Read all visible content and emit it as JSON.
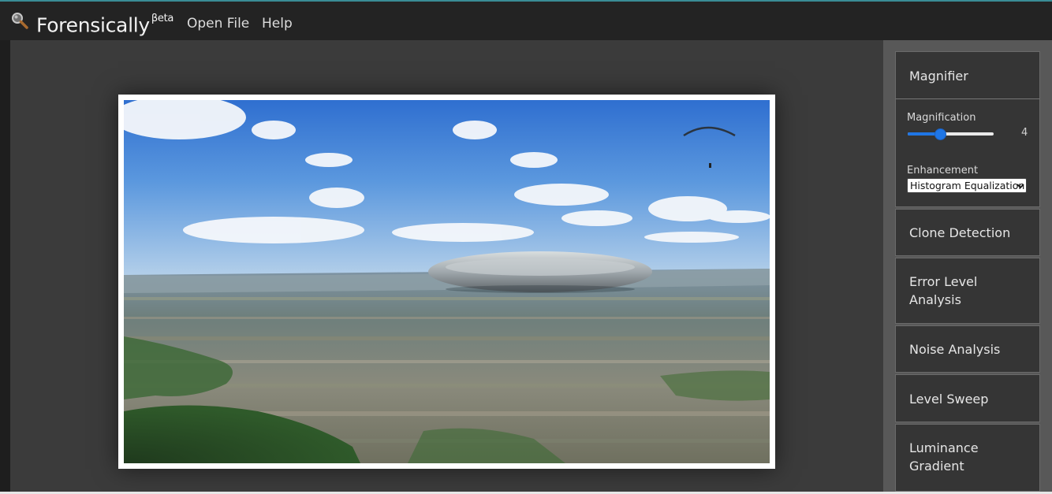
{
  "header": {
    "logo_icon": "magnifying-glass-icon",
    "title": "Forensically",
    "title_sup": "βeta",
    "menu": [
      {
        "label": "Open File"
      },
      {
        "label": "Help"
      }
    ]
  },
  "sidebar": {
    "magnifier": {
      "title": "Magnifier",
      "magnification_label": "Magnification",
      "magnification_value": "4",
      "magnification_fraction": 0.35,
      "enhancement_label": "Enhancement",
      "enhancement_selected": "Histogram Equalization"
    },
    "tools": [
      {
        "label": "Clone Detection"
      },
      {
        "label": "Error Level Analysis"
      },
      {
        "label": "Noise Analysis"
      },
      {
        "label": "Level Sweep"
      },
      {
        "label": "Luminance Gradient"
      }
    ]
  },
  "colors": {
    "accent": "#1f76e6",
    "header_bg": "#232323",
    "workspace_bg": "#3b3b3b",
    "panel_bg": "#353535"
  }
}
